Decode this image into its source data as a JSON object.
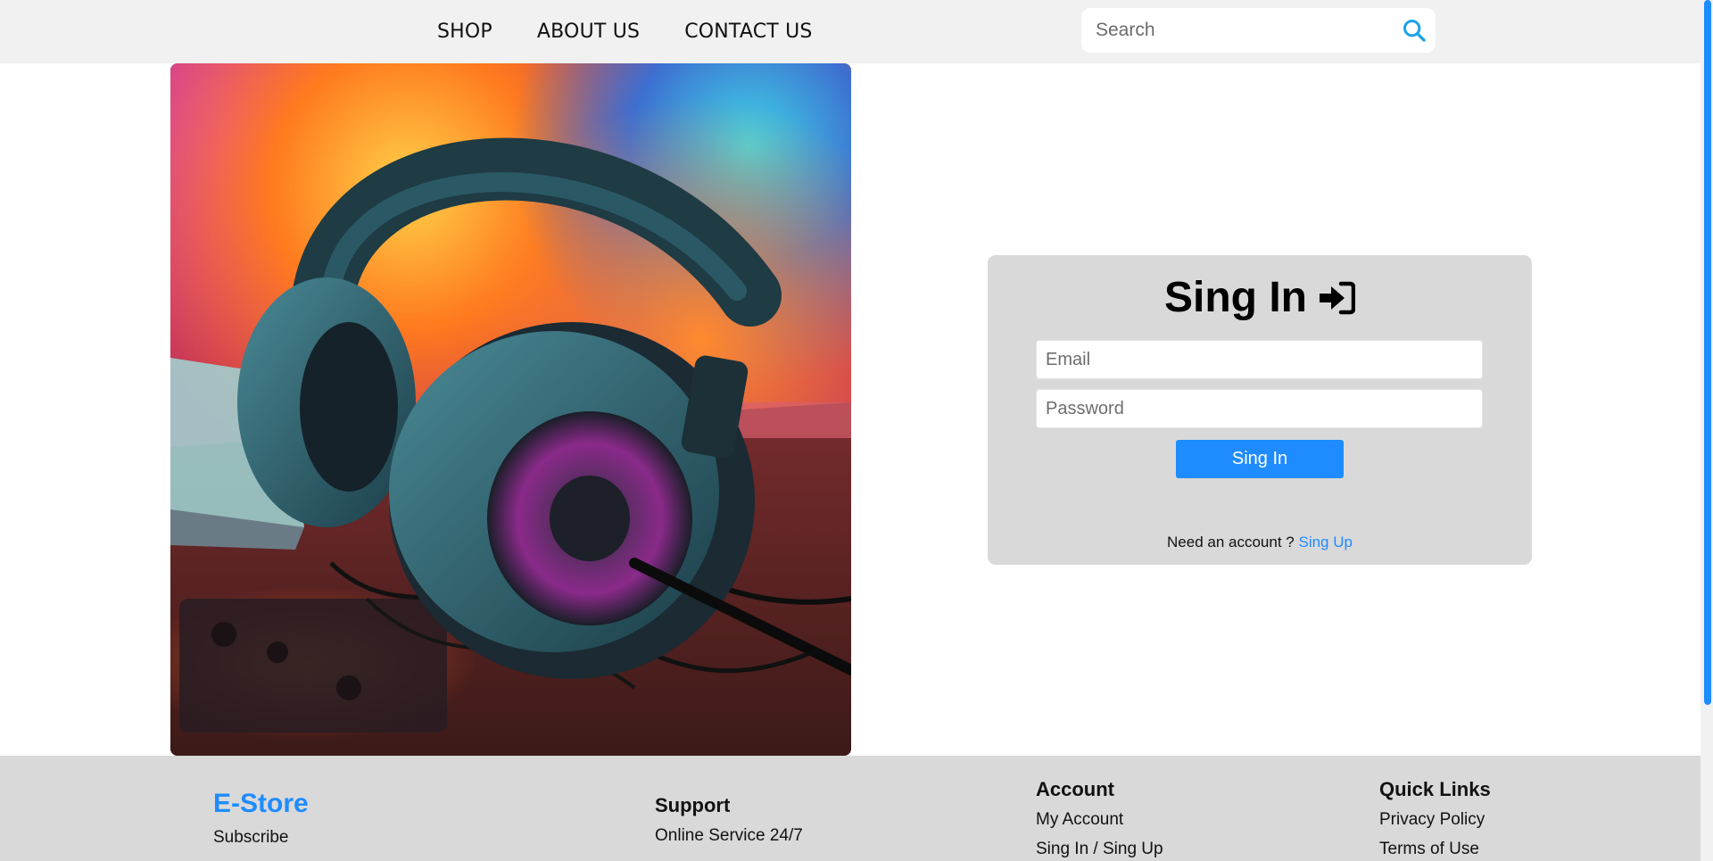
{
  "nav": {
    "links": [
      "SHOP",
      "ABOUT US",
      "CONTACT US"
    ]
  },
  "search": {
    "placeholder": "Search",
    "icon": "search-icon"
  },
  "hero": {
    "icon": "headphones-image"
  },
  "signin": {
    "title": "Sing In",
    "title_icon": "sign-in-icon",
    "email_placeholder": "Email",
    "password_placeholder": "Password",
    "button_label": "Sing In",
    "account_prompt": "Need an account ?",
    "signup_link": "Sing Up"
  },
  "footer": {
    "brand": "E-Store",
    "subscribe": "Subscribe",
    "support": {
      "heading": "Support",
      "items": [
        "Online Service 24/7"
      ]
    },
    "account": {
      "heading": "Account",
      "items": [
        "My Account",
        "Sing In / Sing Up"
      ]
    },
    "quick_links": {
      "heading": "Quick Links",
      "items": [
        "Privacy Policy",
        "Terms of Use"
      ]
    }
  },
  "colors": {
    "accent": "#1e8cff",
    "header_bg": "#f1f1f1",
    "card_bg": "#d9d9d9",
    "footer_bg": "#d9d9d9"
  }
}
